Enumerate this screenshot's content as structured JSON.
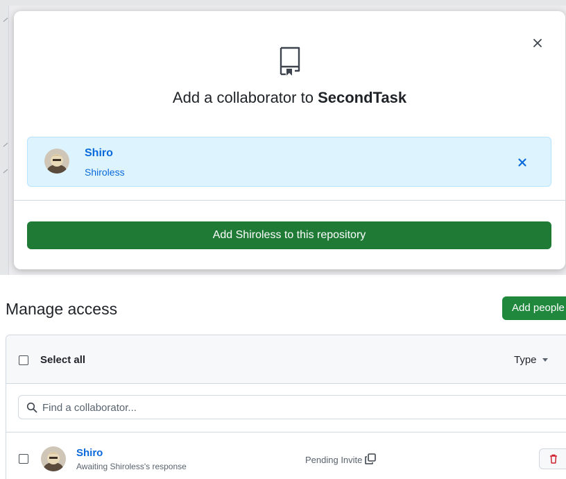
{
  "modal": {
    "title_prefix": "Add a collaborator to",
    "repo_name": "SecondTask",
    "selected_user": {
      "name": "Shiro",
      "login": "Shiroless"
    },
    "add_button_label": "Add Shiroless to this repository"
  },
  "manage_access": {
    "title": "Manage access",
    "add_people_label": "Add people",
    "select_all_label": "Select all",
    "type_filter_label": "Type",
    "search_placeholder": "Find a collaborator...",
    "collaborators": [
      {
        "name": "Shiro",
        "status": "Awaiting Shiroless's response",
        "invite_state": "Pending Invite"
      }
    ]
  },
  "colors": {
    "primary_green": "#1f883d",
    "link_blue": "#0969da",
    "selected_bg": "#ddf4ff",
    "danger_red": "#cf222e"
  },
  "icons": [
    "repo-icon",
    "close-icon",
    "search-icon",
    "copy-icon",
    "trash-icon",
    "chevron-down-icon"
  ]
}
